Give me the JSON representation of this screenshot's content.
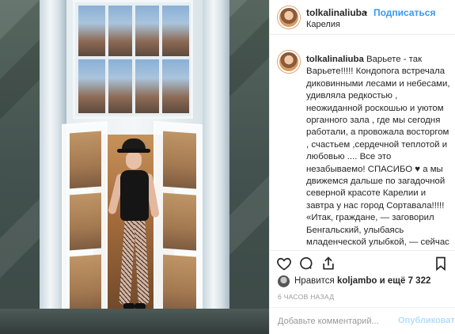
{
  "post": {
    "username": "tolkalinaliuba",
    "follow_label": "Подписаться",
    "separator": "•",
    "location": "Карелия",
    "caption_text": " Варьете - так Варьете!!!!! Кондопога встречала диковинными лесами и небесами, удивляла редкостью , неожиданной роскошью и уютом органного зала , где мы сегодня работали, а провожала восторгом , счастьем ,сердечной теплотой и любовью .... Все это незабываемо! СПАСИБО ♥ а мы движемся дальше по загадочной северной красоте Карелии и завтра у нас город Сортавала!!!!! «Итак, граждане, — заговорил Бенгальский, улыбаясь младенческой улыбкой, — сейчас перед вами выступит... — тут Бенгальский прервал сам себя и заговорил с другими интонациями: — Я вижу, что количество публики к третьему отделению еще увеличилось. У нас сегодня",
    "likes_prefix": "Нравится ",
    "likes_user": "koljambo",
    "likes_suffix": " и ещё 7 322",
    "time_ago": "6 ЧАСОВ НАЗАД",
    "comment_placeholder": "Добавьте комментарий...",
    "publish_label": "Опубликовать"
  },
  "icons": {
    "like": "heart-icon",
    "comment": "comment-icon",
    "share": "share-icon",
    "save": "bookmark-icon"
  },
  "colors": {
    "link_blue": "#3897f0",
    "publish_disabled": "#b2dffc",
    "muted_text": "#999999"
  }
}
